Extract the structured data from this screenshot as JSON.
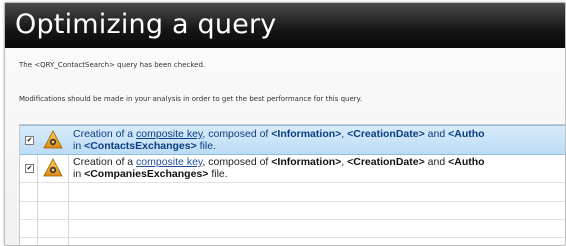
{
  "window": {
    "title": "Optimizing a query"
  },
  "messages": {
    "checked": "The <QRY_ContactSearch> query has been checked.",
    "advice": "Modifications should be made in your analysis in order to get the best performance for this query."
  },
  "suggestions": [
    {
      "checked": true,
      "selected": true,
      "icon": "optimization-warning-icon",
      "prefix": "Creation of a ",
      "link": "composite key",
      "middle": ", composed of ",
      "field1": "<Information>",
      "sep1": ", ",
      "field2": "<CreationDate>",
      "sep2": " and ",
      "field3": "<Autho",
      "line2_prefix": "in ",
      "file": "<ContactsExchanges>",
      "line2_suffix": " file."
    },
    {
      "checked": true,
      "selected": false,
      "icon": "optimization-warning-icon",
      "prefix": "Creation of a ",
      "link": "composite key",
      "middle": ", composed of ",
      "field1": "<Information>",
      "sep1": ", ",
      "field2": "<CreationDate>",
      "sep2": " and ",
      "field3": "<Autho",
      "line2_prefix": "in ",
      "file": "<CompaniesExchanges>",
      "line2_suffix": " file."
    }
  ],
  "colors": {
    "title_bar": "#151515",
    "selected_row": "#bcdcf5",
    "link": "#1f4f9a"
  }
}
